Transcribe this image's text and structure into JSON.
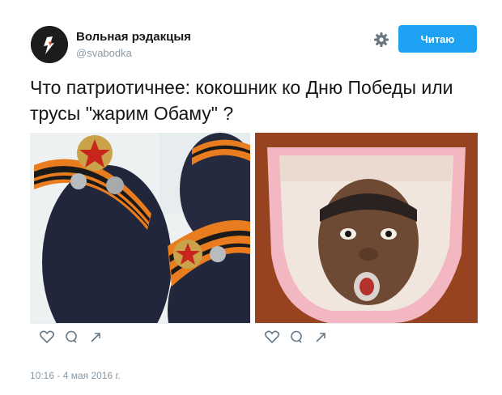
{
  "author": {
    "name": "Вольная рэдакцыя",
    "handle": "@svabodka",
    "avatar_icon": "torch-logo-icon"
  },
  "actions": {
    "settings_icon": "gear-icon",
    "follow_label": "Читаю"
  },
  "tweet": {
    "text": "Что патриотичнее: кокошник ко Дню Победы или трусы \"жарим Обаму\" ?",
    "timestamp": "10:16 - 4 мая 2016 г."
  },
  "photos": [
    {
      "alt": "military headbands photo",
      "icons": [
        "heart-icon",
        "comment-icon",
        "share-icon"
      ]
    },
    {
      "alt": "printed underwear photo",
      "icons": [
        "heart-icon",
        "comment-icon",
        "share-icon"
      ]
    }
  ],
  "colors": {
    "accent": "#1da1f2",
    "text": "#14171a",
    "muted": "#8899a6"
  }
}
